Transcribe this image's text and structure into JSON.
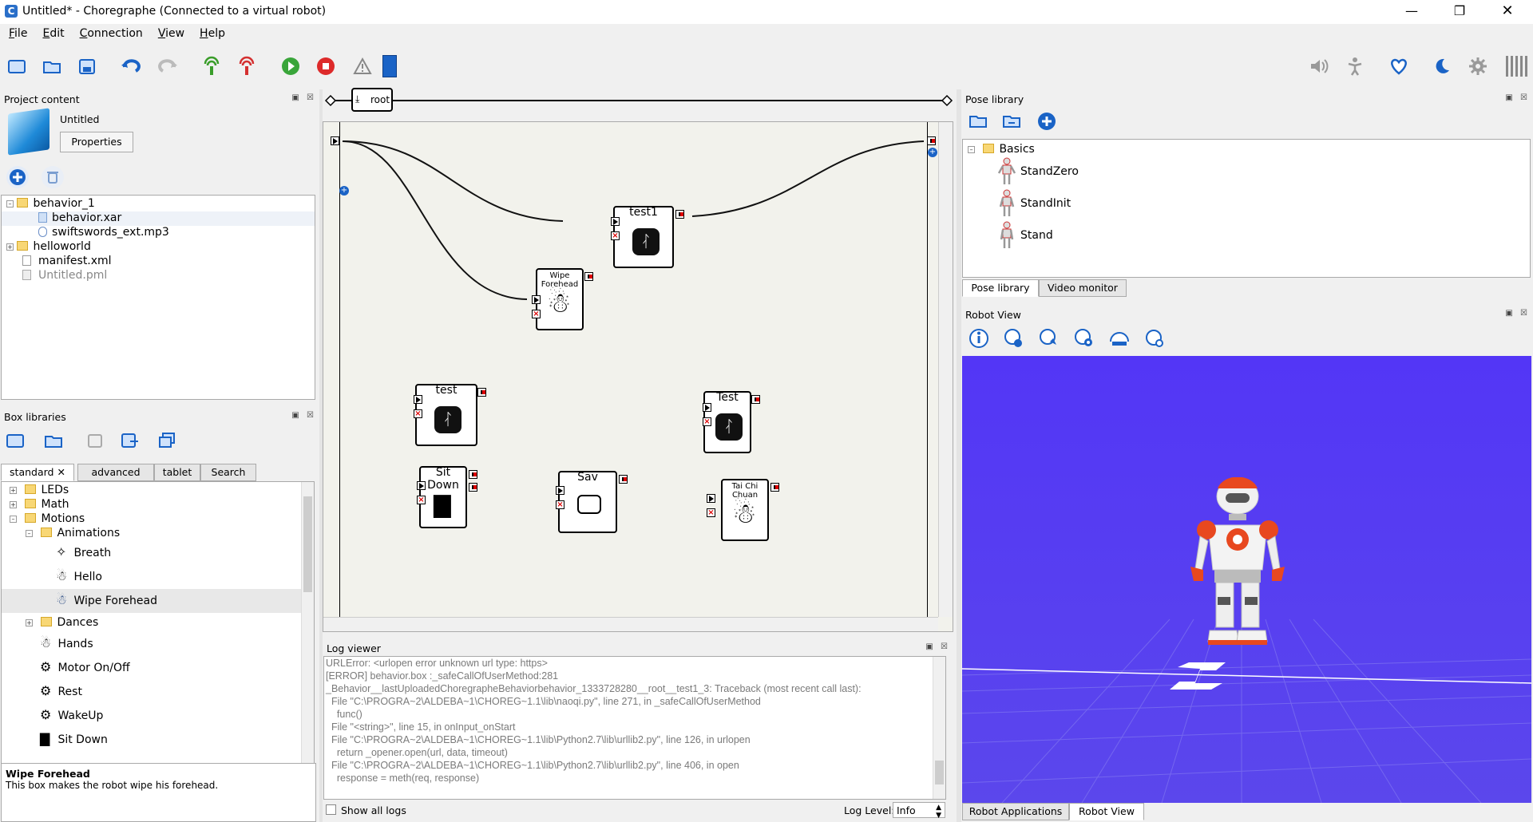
{
  "window": {
    "title": "Untitled* - Choregraphe (Connected to a virtual robot)",
    "app_icon": "C"
  },
  "menu": [
    "File",
    "Edit",
    "Connection",
    "View",
    "Help"
  ],
  "menu_underline": [
    "F",
    "E",
    "C",
    "V",
    "H"
  ],
  "project": {
    "header": "Project content",
    "name": "Untitled",
    "properties_label": "Properties",
    "tree": [
      "behavior_1",
      "behavior.xar",
      "swiftswords_ext.mp3",
      "helloworld",
      "manifest.xml",
      "Untitled.pml"
    ]
  },
  "box_libraries": {
    "header": "Box libraries",
    "tabs": [
      "standard",
      "advanced",
      "tablet",
      "Search"
    ],
    "items": [
      "LEDs",
      "Math",
      "Motions",
      "Animations",
      "Breath",
      "Hello",
      "Wipe Forehead",
      "Dances",
      "Hands",
      "Motor On/Off",
      "Rest",
      "WakeUp",
      "Sit Down"
    ],
    "description_title": "Wipe Forehead",
    "description_text": "This box makes the robot wipe his forehead."
  },
  "flow": {
    "root_label": "root",
    "boxes": [
      "test1",
      "Wipe Forehead",
      "test",
      "Test",
      "Sit Down",
      "Sav",
      "Tai Chi Chuan"
    ]
  },
  "log_viewer": {
    "header": "Log viewer",
    "lines": [
      "URLError: <urlopen error unknown url type: https>",
      "",
      "[ERROR] behavior.box :_safeCallOfUserMethod:281",
      "_Behavior__lastUploadedChoregrapheBehaviorbehavior_1333728280__root__test1_3: Traceback (most recent call last):",
      "  File \"C:\\PROGRA~2\\ALDEBA~1\\CHOREG~1.1\\lib\\naoqi.py\", line 271, in _safeCallOfUserMethod",
      "    func()",
      "  File \"<string>\", line 15, in onInput_onStart",
      "  File \"C:\\PROGRA~2\\ALDEBA~1\\CHOREG~1.1\\lib\\Python2.7\\lib\\urllib2.py\", line 126, in urlopen",
      "    return _opener.open(url, data, timeout)",
      "  File \"C:\\PROGRA~2\\ALDEBA~1\\CHOREG~1.1\\lib\\Python2.7\\lib\\urllib2.py\", line 406, in open",
      "    response = meth(req, response)"
    ],
    "show_all_label": "Show all logs",
    "level_label": "Log Level:",
    "level_value": "Info"
  },
  "pose_library": {
    "header": "Pose library",
    "folder": "Basics",
    "poses": [
      "StandZero",
      "StandInit",
      "Stand"
    ],
    "tabs": [
      "Pose library",
      "Video monitor"
    ]
  },
  "robot_view": {
    "header": "Robot View",
    "tabs": [
      "Robot Applications",
      "Robot View"
    ]
  },
  "colors": {
    "accent": "#1a63c6",
    "viewport": "#5a3df5",
    "robot_orange": "#e8481f"
  }
}
